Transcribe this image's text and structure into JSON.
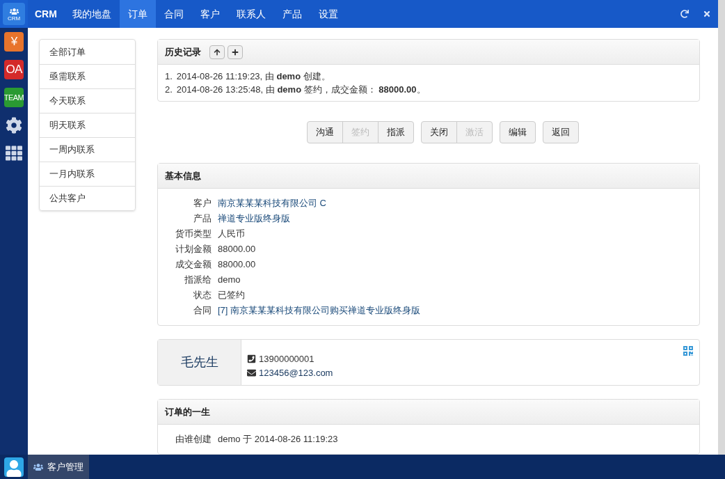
{
  "dock": {
    "apps": [
      {
        "kind": "logo",
        "label": "CRM",
        "selected": true
      },
      {
        "kind": "tile",
        "label": "¥",
        "color": "#e8742c",
        "selected": false
      },
      {
        "kind": "tile",
        "label": "OA",
        "color": "#d42a2a",
        "selected": false
      },
      {
        "kind": "tile",
        "label": "TEAM",
        "color": "#2a9a32",
        "selected": false
      },
      {
        "kind": "settings",
        "selected": false
      },
      {
        "kind": "apps",
        "selected": false
      }
    ]
  },
  "navbar": {
    "brand": "CRM",
    "items": [
      {
        "label": "我的地盘",
        "selected": false
      },
      {
        "label": "订单",
        "selected": true
      },
      {
        "label": "合同",
        "selected": false
      },
      {
        "label": "客户",
        "selected": false
      },
      {
        "label": "联系人",
        "selected": false
      },
      {
        "label": "产品",
        "selected": false
      },
      {
        "label": "设置",
        "selected": false
      }
    ]
  },
  "side_menu": [
    "全部订单",
    "亟需联系",
    "今天联系",
    "明天联系",
    "一周内联系",
    "一月内联系",
    "公共客户"
  ],
  "history": {
    "title": "历史记录",
    "entries": [
      {
        "number": "1.",
        "text": "2014-08-26 11:19:23, 由 **demo** 创建。"
      },
      {
        "number": "2.",
        "text": "2014-08-26 13:25:48, 由 **demo** 签约，成交金额： **88000.00**。"
      }
    ]
  },
  "actions": [
    [
      {
        "label": "沟通",
        "disabled": false
      },
      {
        "label": "签约",
        "disabled": true
      },
      {
        "label": "指派",
        "disabled": false
      }
    ],
    [
      {
        "label": "关闭",
        "disabled": false
      },
      {
        "label": "激活",
        "disabled": true
      }
    ],
    [
      {
        "label": "编辑",
        "disabled": false
      }
    ],
    [
      {
        "label": "返回",
        "disabled": false
      }
    ]
  ],
  "basic_info": {
    "title": "基本信息",
    "rows": [
      {
        "label": "客户",
        "value": "南京某某某科技有限公司 C",
        "link": true
      },
      {
        "label": "产品",
        "value": "禅道专业版终身版",
        "link": true
      },
      {
        "label": "货币类型",
        "value": "人民币",
        "link": false
      },
      {
        "label": "计划金额",
        "value": "88000.00",
        "link": false
      },
      {
        "label": "成交金额",
        "value": "88000.00",
        "link": false
      },
      {
        "label": "指派给",
        "value": "demo",
        "link": false
      },
      {
        "label": "状态",
        "value": "已签约",
        "link": false
      },
      {
        "label": "合同",
        "value": "[7] 南京某某某科技有限公司购买禅道专业版终身版",
        "link": true
      }
    ]
  },
  "contact": {
    "name": "毛先生",
    "phone": "13900000001",
    "email": "123456@123.com"
  },
  "lifecycle": {
    "title": "订单的一生",
    "rows": [
      {
        "label": "由谁创建",
        "value": "demo 于 2014-08-26 11:19:23"
      }
    ]
  },
  "taskbar": {
    "tasks": [
      {
        "label": "客户管理",
        "selected": true
      }
    ]
  }
}
